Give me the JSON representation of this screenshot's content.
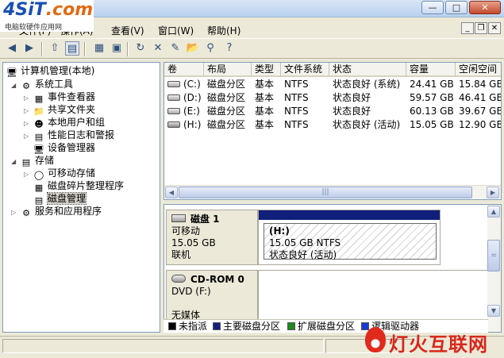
{
  "watermark": {
    "logo_main": "4SiT",
    "logo_tld": ".com",
    "logo_sub": "电脑软硬件应用网",
    "bottom_text": "灯火互联网"
  },
  "window_buttons": {
    "minimize": "—",
    "maximize": "□",
    "close": "✕"
  },
  "menu": {
    "file": "文件(F)",
    "action": "操作(A)",
    "view": "查看(V)",
    "window": "窗口(W)",
    "help": "帮助(H)"
  },
  "mdi_buttons": {
    "minimize": "_",
    "restore": "❐",
    "close": "✕"
  },
  "toolbar": {
    "icons": [
      "back-arrow-icon",
      "forward-arrow-icon",
      "up-folder-icon",
      "show-tree-icon",
      "export-icon",
      "refresh-icon",
      "delete-icon",
      "properties-icon",
      "open-icon",
      "search-icon",
      "help-icon"
    ]
  },
  "tree": {
    "root": "计算机管理(本地)",
    "system_tools": "系统工具",
    "event_viewer": "事件查看器",
    "shared_folders": "共享文件夹",
    "local_users": "本地用户和组",
    "perf_logs": "性能日志和警报",
    "device_manager": "设备管理器",
    "storage": "存储",
    "removable_storage": "可移动存储",
    "defrag": "磁盘碎片整理程序",
    "disk_mgmt": "磁盘管理",
    "services_apps": "服务和应用程序"
  },
  "volume_list": {
    "headers": [
      "卷",
      "布局",
      "类型",
      "文件系统",
      "状态",
      "容量",
      "空闲空间"
    ],
    "rows": [
      [
        "(C:)",
        "磁盘分区",
        "基本",
        "NTFS",
        "状态良好 (系统)",
        "24.41 GB",
        "15.84 GB"
      ],
      [
        "(D:)",
        "磁盘分区",
        "基本",
        "NTFS",
        "状态良好",
        "59.57 GB",
        "46.41 GB"
      ],
      [
        "(E:)",
        "磁盘分区",
        "基本",
        "NTFS",
        "状态良好",
        "60.13 GB",
        "39.67 GB"
      ],
      [
        "(H:)",
        "磁盘分区",
        "基本",
        "NTFS",
        "状态良好 (活动)",
        "15.05 GB",
        "12.90 GB"
      ]
    ]
  },
  "graph": {
    "disk1": {
      "name": "磁盘 1",
      "type": "可移动",
      "size": "15.05 GB",
      "status": "联机",
      "partition": {
        "label": "(H:)",
        "size_fs": "15.05 GB NTFS",
        "status": "状态良好 (活动)"
      }
    },
    "cdrom": {
      "name": "CD-ROM 0",
      "drive": "DVD (F:)",
      "media": "无媒体"
    }
  },
  "legend": [
    {
      "label": "未指派",
      "color": "#000000"
    },
    {
      "label": "主要磁盘分区",
      "color": "#10207a"
    },
    {
      "label": "扩展磁盘分区",
      "color": "#1f8a1f"
    },
    {
      "label": "逻辑驱动器",
      "color": "#1a3ad6"
    }
  ]
}
